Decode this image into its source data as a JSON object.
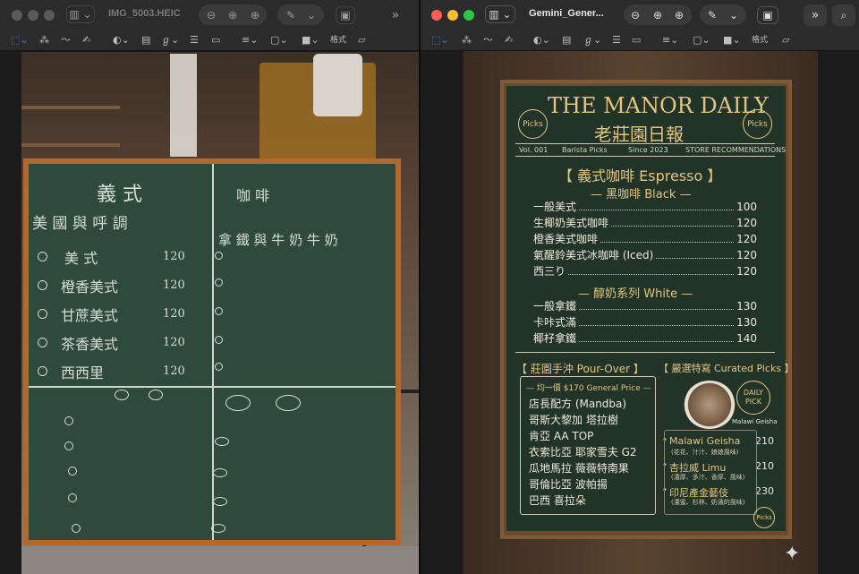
{
  "left_window": {
    "title": "IMG_5003.HEIC",
    "format_label": "格式",
    "icons": [
      "sidebar-icon",
      "zoom-out-icon",
      "zoom-in-icon",
      "zoom-fit-icon",
      "markup-pen-icon",
      "crop-icon",
      "more-icon",
      "search-icon"
    ],
    "chalkboard": {
      "q1_heading": "義 式",
      "q1_sub": "美 國 與 呼 調",
      "q1_items": [
        {
          "name": "美 式",
          "price": "120"
        },
        {
          "name": "橙香美式",
          "price": "120"
        },
        {
          "name": "甘蔗美式",
          "price": "120"
        },
        {
          "name": "茶香美式",
          "price": "120"
        },
        {
          "name": "西西里",
          "price": "120"
        }
      ],
      "q2_heading": "咖 啡",
      "q2_sub": "拿 鐵 與 牛 奶 牛 奶"
    }
  },
  "right_window": {
    "title": "Gemini_Gener...",
    "format_label": "格式",
    "menu": {
      "title_en": "THE MANOR DAILY",
      "title_zh": "老莊園日報",
      "badge_left": "Picks",
      "badge_right": "Picks",
      "info": [
        "Vol. 001",
        "Barista Picks",
        "Since 2023",
        "STORE RECOMMENDATIONS"
      ],
      "espresso_heading": "【 義式咖啡 Espresso 】",
      "black_heading": "— 黑咖啡 Black —",
      "black_items": [
        {
          "name": "一般美式",
          "price": "100"
        },
        {
          "name": "生椰奶美式咖啡",
          "price": "120"
        },
        {
          "name": "橙香美式咖啡",
          "price": "120"
        },
        {
          "name": "氣醒鈴美式冰咖啡 (Iced)",
          "price": "120"
        },
        {
          "name": "西三り",
          "price": "120"
        }
      ],
      "white_heading": "— 醇奶系列 White —",
      "white_items": [
        {
          "name": "一般拿鐵",
          "price": "130"
        },
        {
          "name": "卡咔式滿",
          "price": "130"
        },
        {
          "name": "椰杍拿鐵",
          "price": "140"
        }
      ],
      "pourover_heading": "【 莊園手沖 Pour-Over 】",
      "pourover_price": "— 均一價 $170 General Price —",
      "pourover_items": [
        "店長配方 (Mandba)",
        "哥斯大黎加 塔拉樹",
        "肯亞 AA TOP",
        "衣索比亞 耶家雪夫 G2",
        "瓜地馬拉 薇薇特南果",
        "哥倫比亞 波帕揚",
        "巴西 喜拉朵"
      ],
      "curated_heading": "【 嚴選特寫 Curated Picks 】",
      "daily_pick": "DAILY PICK",
      "daily_caption": "Malawi Geisha",
      "curated_items": [
        {
          "name": "Malawi Geisha",
          "price": "210",
          "note": "(花花、汁汁、娘娘風味)"
        },
        {
          "name": "杏拉威 Limu",
          "price": "210",
          "note": "(濃厚、多汁、香厚、風味)"
        },
        {
          "name": "印尼產金藝伎",
          "price": "230",
          "note": "(濃蜜、杉林、奶漬的風味)"
        }
      ],
      "corner_badge": "Picks"
    }
  },
  "colors": {
    "board_green": "#2e4a3c",
    "poster_green": "#213427",
    "gold": "#e3c580",
    "frame": "#b06a2e"
  }
}
